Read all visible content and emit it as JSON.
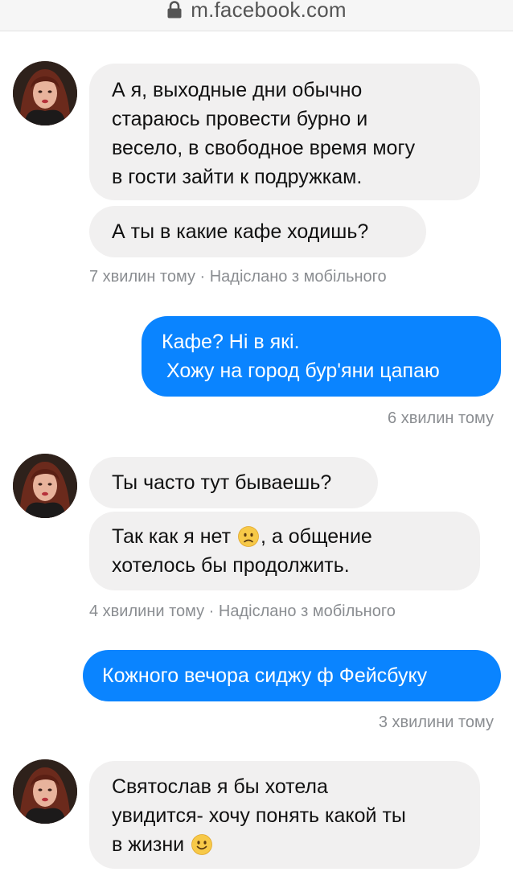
{
  "browser": {
    "url": "m.facebook.com",
    "lock_icon": "lock-icon"
  },
  "colors": {
    "incoming_bubble": "#f1f0f0",
    "outgoing_bubble": "#0a84ff",
    "meta_text": "#8a8d91"
  },
  "messages": [
    {
      "direction": "incoming",
      "lines": [
        "А я, выходные дни обычно",
        "стараюсь провести бурно и",
        "весело, в свободное время могу",
        "в гости зайти к подружкам."
      ]
    },
    {
      "direction": "incoming",
      "lines": [
        "А ты в какие кафе ходишь?"
      ],
      "meta": "7 хвилин тому · Надіслано з мобільного"
    },
    {
      "direction": "outgoing",
      "lines": [
        "Кафе? Ні в які.",
        "Хожу на город бур'яни цапаю"
      ],
      "meta": "6 хвилин тому"
    },
    {
      "direction": "incoming",
      "lines": [
        "Ты часто тут бываешь?"
      ]
    },
    {
      "direction": "incoming",
      "lines": [
        "Так как я нет",
        ", а общение",
        "хотелось бы продолжить."
      ],
      "emoji": "slightly-frowning-face-emoji",
      "meta": "4 хвилини тому · Надіслано з мобільного"
    },
    {
      "direction": "outgoing",
      "lines": [
        "Кожного вечора сиджу ф Фейсбуку"
      ],
      "meta": "3 хвилини тому"
    },
    {
      "direction": "incoming",
      "lines": [
        "Святослав я бы хотела",
        "увидится- хочу понять какой ты",
        "в жизни"
      ],
      "emoji": "smiling-face-emoji"
    }
  ]
}
